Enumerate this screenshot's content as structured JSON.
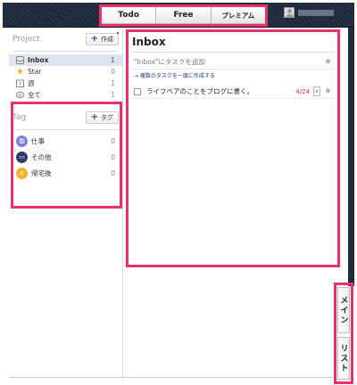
{
  "header": {
    "tabs": [
      {
        "label": "Todo",
        "active": true
      },
      {
        "label": "Free",
        "active": false
      },
      {
        "label": "プレミアム",
        "active": false
      }
    ]
  },
  "sidebar": {
    "project": {
      "title": "Project",
      "add_label": "作成",
      "items": [
        {
          "label": "Inbox",
          "count": "1",
          "icon": "inbox-icon",
          "active": true
        },
        {
          "label": "Star",
          "count": "0",
          "icon": "star-icon"
        },
        {
          "label": "週",
          "count": "1",
          "icon": "calendar-icon"
        },
        {
          "label": "全て",
          "count": "1",
          "icon": "infinity-icon"
        }
      ]
    },
    "tag": {
      "title": "Tag",
      "add_label": "タグ",
      "items": [
        {
          "label": "仕事",
          "count": "0",
          "icon": "building-icon",
          "color": "#7c7fd6"
        },
        {
          "label": "その他",
          "count": "0",
          "icon": "monitor-icon",
          "color": "#2f3b6a"
        },
        {
          "label": "帰宅後",
          "count": "0",
          "icon": "home-icon",
          "color": "#f0b429"
        }
      ]
    }
  },
  "main": {
    "title": "Inbox",
    "input_placeholder": "\"Inbox\"にタスクを追加",
    "bulk_link": "→ 複数のタスクを一度に作成する",
    "tasks": [
      {
        "text": "ライフベアのことをブログに書く。",
        "date": "4/24",
        "starred": false
      }
    ]
  },
  "vertical_tabs": [
    {
      "label": "メイン"
    },
    {
      "label": "リスト"
    }
  ],
  "colors": {
    "highlight": "#e8306d",
    "header_bg": "#1f2a3d",
    "accent": "#1a4a8a",
    "due_date": "#c0392b"
  }
}
